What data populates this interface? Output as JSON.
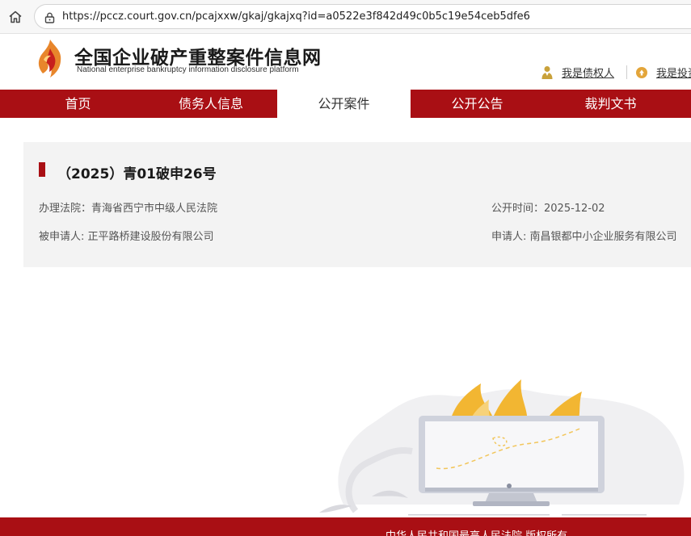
{
  "browser": {
    "url": "https://pccz.court.gov.cn/pcajxxw/gkaj/gkajxq?id=a0522e3f842d49c0b5c19e54ceb5dfe6",
    "home_icon": "home-icon",
    "lock_icon": "lock-icon"
  },
  "header": {
    "title": "全国企业破产重整案件信息网",
    "subtitle": "National enterprise bankruptcy  information disclosure platform",
    "logo_icon": "flame-logo",
    "creditor_link": "我是债权人",
    "investor_link": "我是投资人"
  },
  "nav": {
    "items": [
      {
        "label": "首页"
      },
      {
        "label": "债务人信息"
      },
      {
        "label": "公开案件"
      },
      {
        "label": "公开公告"
      },
      {
        "label": "裁判文书"
      }
    ],
    "active_index": 2
  },
  "case": {
    "title": "（2025）青01破申26号",
    "court_label": "办理法院：青海省西宁市中级人民法院",
    "date_label": "公开时间：2025-12-02",
    "respondent_label": "被申请人: 正平路桥建设股份有限公司",
    "applicant_label": "申请人: 南昌银都中小企业服务有限公司"
  },
  "footer": {
    "text": "中华人民共和国最高人民法院 版权所有"
  },
  "colors": {
    "brand_red": "#a90f14",
    "card_bg": "#f3f3f3",
    "flame_orange": "#f0b429"
  }
}
